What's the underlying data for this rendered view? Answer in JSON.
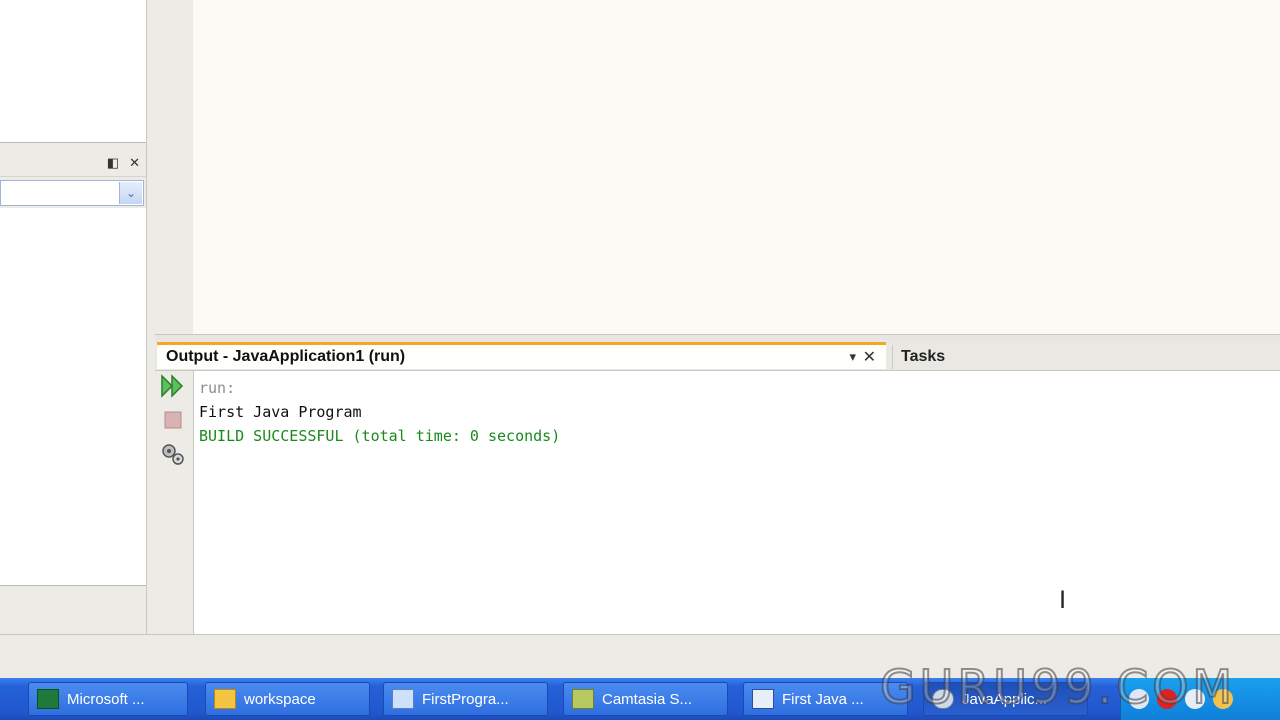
{
  "output_window": {
    "tab_title": "Output - JavaApplication1 (run)",
    "tasks_tab": "Tasks",
    "console_lines": [
      "run:",
      "First Java Program",
      "BUILD SUCCESSFUL (total time: 0 seconds)"
    ],
    "colors": {
      "run": "#8c8c8c",
      "normal": "#111111",
      "success": "#1a8a1a",
      "active_tab_accent": "#f5a623"
    }
  },
  "left_panel": {
    "header_icons": [
      "minimize-window-icon",
      "close-icon"
    ]
  },
  "taskbar": {
    "items": [
      {
        "label": "Microsoft ...",
        "icon": "excel-icon"
      },
      {
        "label": "workspace",
        "icon": "folder-icon"
      },
      {
        "label": "FirstProgra...",
        "icon": "document-icon"
      },
      {
        "label": "Camtasia S...",
        "icon": "camtasia-icon"
      },
      {
        "label": "First Java ...",
        "icon": "word-icon"
      },
      {
        "label": "JavaApplic...",
        "icon": "netbeans-icon"
      }
    ]
  },
  "watermark": "GURU99.COM"
}
